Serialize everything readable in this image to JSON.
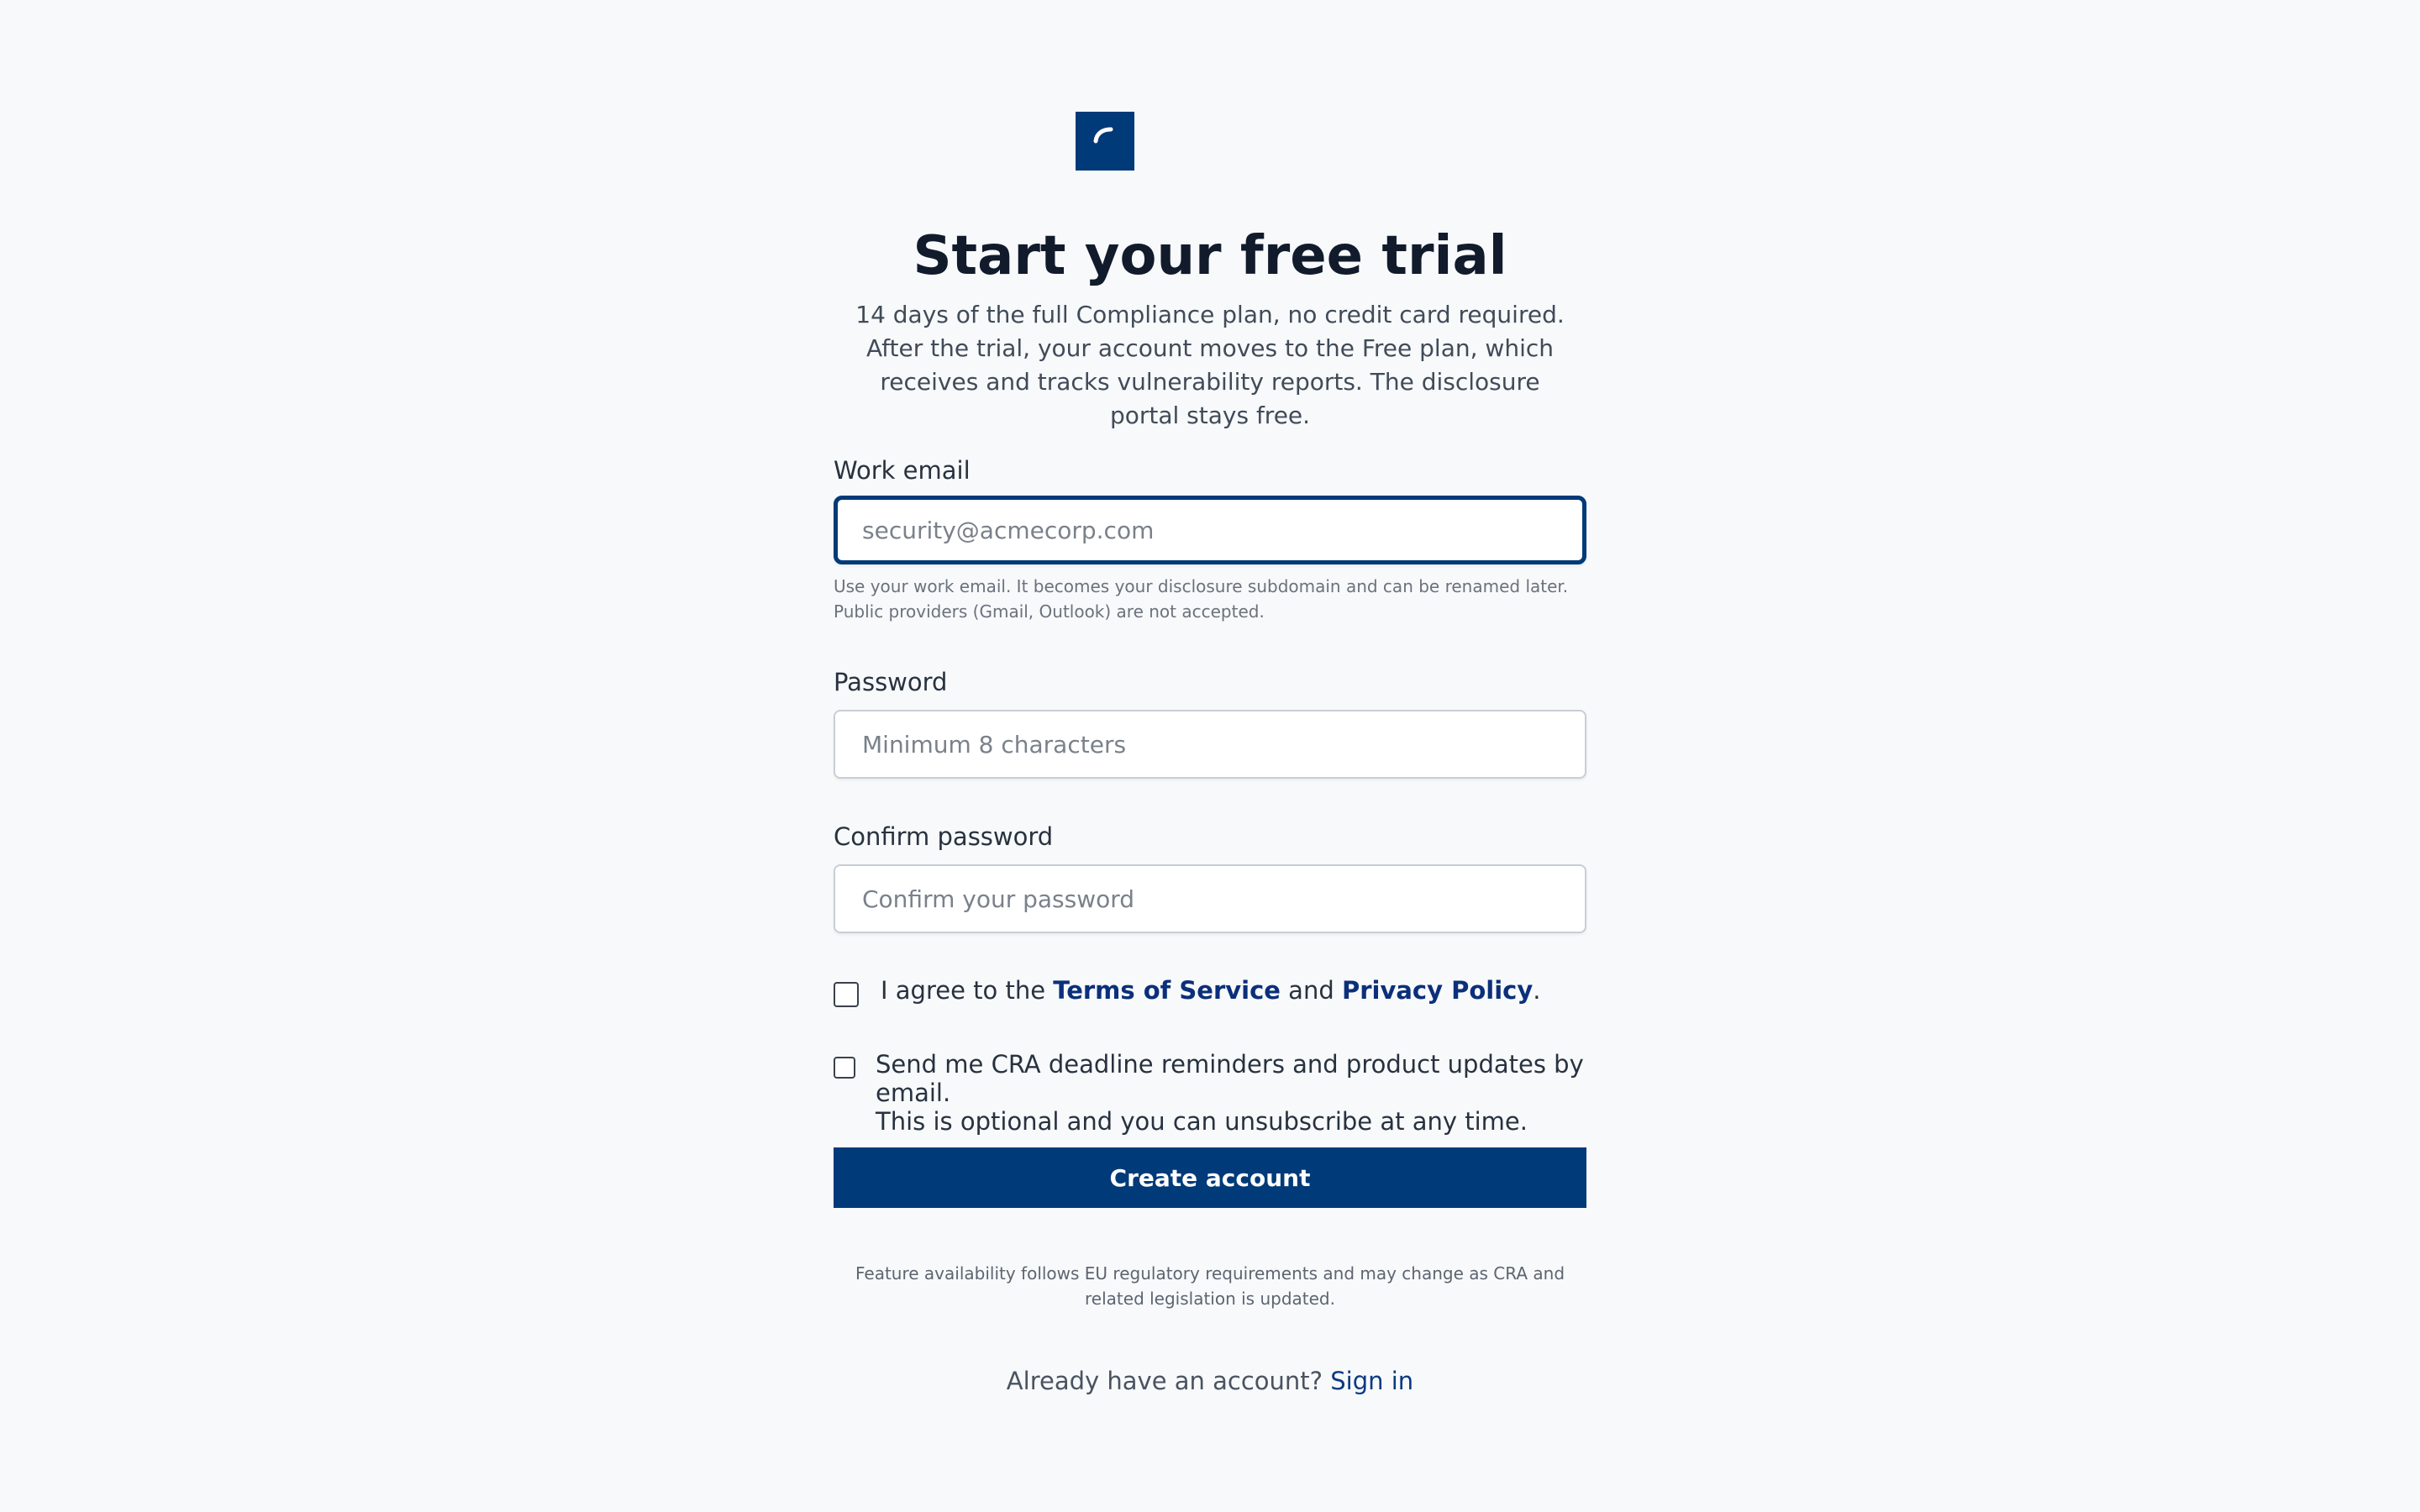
{
  "brand": {
    "logo_icon": "brand-logo-icon",
    "accent": "#003a78"
  },
  "header": {
    "title": "Start your free trial",
    "subtitle": "14 days of the full Compliance plan, no credit card required. After the trial, your account moves to the Free plan, which receives and tracks vulnerability reports. The disclosure portal stays free."
  },
  "form": {
    "email": {
      "label": "Work email",
      "placeholder": "security@acmecorp.com",
      "value": "",
      "hint": "Use your work email. It becomes your disclosure subdomain and can be renamed later. Public providers (Gmail, Outlook) are not accepted."
    },
    "password": {
      "label": "Password",
      "placeholder": "Minimum 8 characters",
      "value": ""
    },
    "confirm_password": {
      "label": "Confirm password",
      "placeholder": "Confirm your password",
      "value": ""
    },
    "terms": {
      "checked": false,
      "prefix": "I agree to the ",
      "terms_link": "Terms of Service",
      "middle": " and ",
      "privacy_link": "Privacy Policy",
      "suffix": "."
    },
    "marketing": {
      "checked": false,
      "text_line1": "Send me CRA deadline reminders and product updates by email.",
      "text_line2": "This is optional and you can unsubscribe at any time."
    },
    "submit_label": "Create account"
  },
  "footer": {
    "note": "Feature availability follows EU regulatory requirements and may change as CRA and related legislation is updated.",
    "signin_prompt": "Already have an account?",
    "signin_link": "Sign in"
  }
}
